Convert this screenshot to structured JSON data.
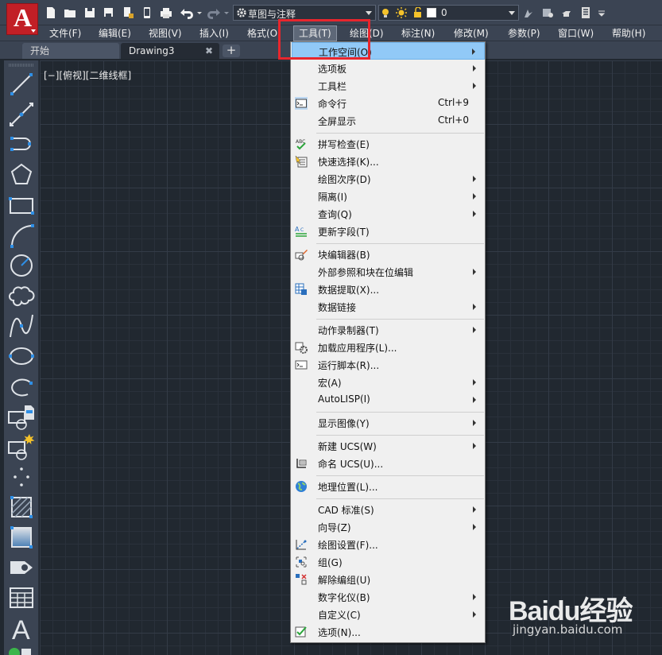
{
  "quick_access": {
    "workspace": "草图与注释",
    "layer": "0"
  },
  "menubar": {
    "items": [
      "文件(F)",
      "编辑(E)",
      "视图(V)",
      "插入(I)",
      "格式(O)",
      "工具(T)",
      "绘图(D)",
      "标注(N)",
      "修改(M)",
      "参数(P)",
      "窗口(W)",
      "帮助(H)"
    ]
  },
  "tabs": {
    "start": "开始",
    "drawing": "Drawing3",
    "close_glyph": "✖",
    "new_tab_glyph": "+"
  },
  "viewport": {
    "label": "[−][俯视][二维线框]"
  },
  "tools_menu": {
    "items": [
      {
        "label": "工作空间(O)",
        "shortcut": "",
        "icon": "",
        "submenu": true
      },
      {
        "label": "选项板",
        "shortcut": "",
        "icon": "",
        "submenu": true
      },
      {
        "label": "工具栏",
        "shortcut": "",
        "icon": "",
        "submenu": true
      },
      {
        "label": "命令行",
        "shortcut": "Ctrl+9",
        "icon": "command-line-icon",
        "submenu": false
      },
      {
        "label": "全屏显示",
        "shortcut": "Ctrl+0",
        "icon": "",
        "submenu": false
      },
      {
        "label": "拼写检查(E)",
        "shortcut": "",
        "icon": "spell-check-icon",
        "submenu": false
      },
      {
        "label": "快速选择(K)...",
        "shortcut": "",
        "icon": "quick-select-icon",
        "submenu": false
      },
      {
        "label": "绘图次序(D)",
        "shortcut": "",
        "icon": "",
        "submenu": true
      },
      {
        "label": "隔离(I)",
        "shortcut": "",
        "icon": "",
        "submenu": true
      },
      {
        "label": "查询(Q)",
        "shortcut": "",
        "icon": "",
        "submenu": true
      },
      {
        "label": "更新字段(T)",
        "shortcut": "",
        "icon": "update-fields-icon",
        "submenu": false
      },
      {
        "label": "块编辑器(B)",
        "shortcut": "",
        "icon": "block-editor-icon",
        "submenu": false
      },
      {
        "label": "外部参照和块在位编辑",
        "shortcut": "",
        "icon": "",
        "submenu": true
      },
      {
        "label": "数据提取(X)...",
        "shortcut": "",
        "icon": "data-extraction-icon",
        "submenu": false
      },
      {
        "label": "数据链接",
        "shortcut": "",
        "icon": "",
        "submenu": true
      },
      {
        "label": "动作录制器(T)",
        "shortcut": "",
        "icon": "",
        "submenu": true
      },
      {
        "label": "加载应用程序(L)...",
        "shortcut": "",
        "icon": "load-application-icon",
        "submenu": false
      },
      {
        "label": "运行脚本(R)...",
        "shortcut": "",
        "icon": "run-script-icon",
        "submenu": false
      },
      {
        "label": "宏(A)",
        "shortcut": "",
        "icon": "",
        "submenu": true
      },
      {
        "label": "AutoLISP(I)",
        "shortcut": "",
        "icon": "",
        "submenu": true
      },
      {
        "label": "显示图像(Y)",
        "shortcut": "",
        "icon": "",
        "submenu": true
      },
      {
        "label": "新建 UCS(W)",
        "shortcut": "",
        "icon": "",
        "submenu": true
      },
      {
        "label": "命名 UCS(U)...",
        "shortcut": "",
        "icon": "named-ucs-icon",
        "submenu": false
      },
      {
        "label": "地理位置(L)...",
        "shortcut": "",
        "icon": "globe-icon",
        "submenu": false
      },
      {
        "label": "CAD 标准(S)",
        "shortcut": "",
        "icon": "",
        "submenu": true
      },
      {
        "label": "向导(Z)",
        "shortcut": "",
        "icon": "",
        "submenu": true
      },
      {
        "label": "绘图设置(F)...",
        "shortcut": "",
        "icon": "drafting-settings-icon",
        "submenu": false
      },
      {
        "label": "组(G)",
        "shortcut": "",
        "icon": "group-icon",
        "submenu": false
      },
      {
        "label": "解除编组(U)",
        "shortcut": "",
        "icon": "ungroup-icon",
        "submenu": false
      },
      {
        "label": "数字化仪(B)",
        "shortcut": "",
        "icon": "",
        "submenu": true
      },
      {
        "label": "自定义(C)",
        "shortcut": "",
        "icon": "",
        "submenu": true
      },
      {
        "label": "选项(N)...",
        "shortcut": "",
        "icon": "options-check-icon",
        "submenu": false
      }
    ]
  },
  "watermark": {
    "brand": "Baidu经验",
    "url": "jingyan.baidu.com"
  },
  "colors": {
    "accent_red": "#e8262d",
    "menu_hover": "#91c9f7",
    "canvas_bg": "#212830"
  }
}
